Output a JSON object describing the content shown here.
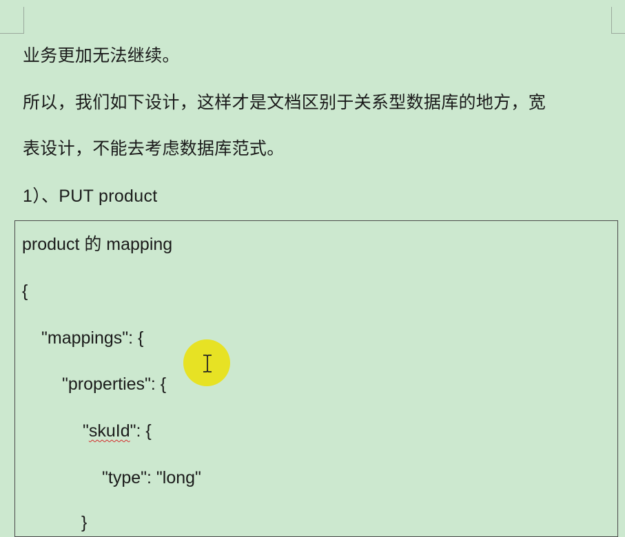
{
  "document": {
    "paragraphs": [
      "业务更加无法继续。",
      "所以，我们如下设计，这样才是文档区别于关系型数据库的地方，宽",
      "表设计，不能去考虑数据库范式。",
      "1）、PUT product"
    ],
    "code": {
      "title": "product 的 mapping",
      "lines": [
        "{",
        "\"mappings\": {",
        "\"properties\": {",
        "\"skuId\": {",
        "\"type\": \"long\"",
        "}"
      ],
      "skuid_prefix": "\"",
      "skuid_word": "skuId",
      "skuid_suffix": "\": {"
    }
  },
  "colors": {
    "background": "#cce8cf",
    "cursor_highlight": "#e8e21a",
    "spellcheck_underline": "#d42a2a"
  },
  "icons": {
    "cursor": "text-ibeam-cursor"
  }
}
